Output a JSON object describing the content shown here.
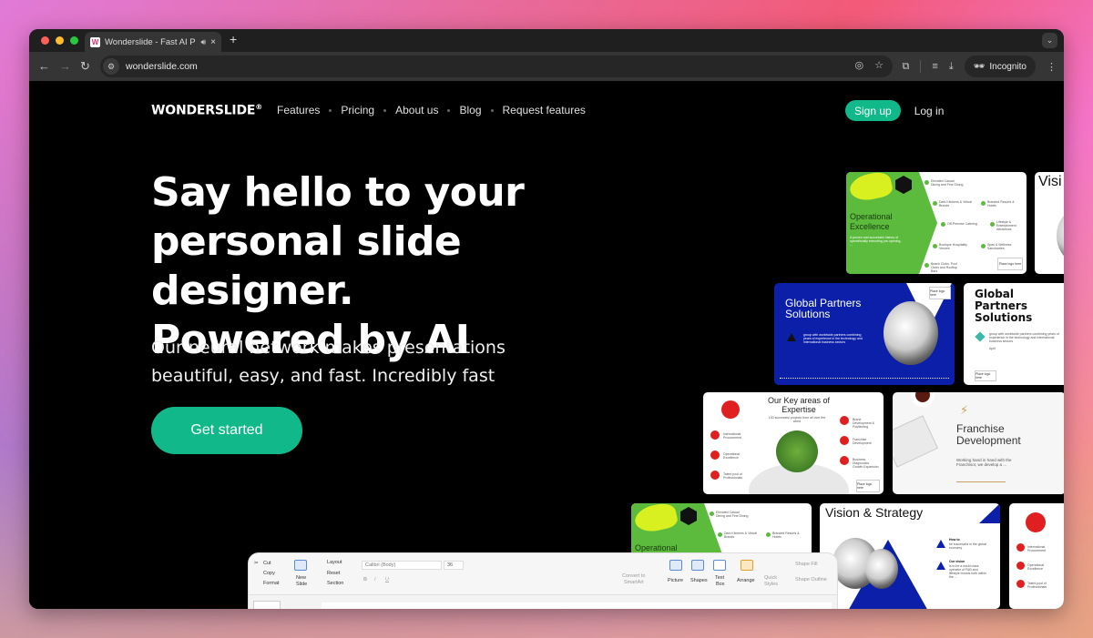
{
  "browser": {
    "tab": {
      "favicon": "W",
      "title": "Wonderslide - Fast AI Presentation Maker",
      "audio_icon": "speaker-icon",
      "close_icon": "×"
    },
    "new_tab": "+",
    "tab_dropdown": "⌄",
    "nav": {
      "back": "←",
      "forward": "→",
      "reload": "↻"
    },
    "address": {
      "site_info_icon": "tune-icon",
      "url": "wonderslide.com"
    },
    "omnibox_icons": [
      "eye-off-icon",
      "star-icon"
    ],
    "right_icons": [
      "extensions-icon",
      "reading-list-icon",
      "download-icon"
    ],
    "incognito_label": "Incognito",
    "menu_icon": "⋮"
  },
  "site": {
    "brand": "WONDERSLIDE",
    "brand_mark": "®",
    "nav_links": [
      "Features",
      "Pricing",
      "About us",
      "Blog",
      "Request features"
    ],
    "signup": "Sign up",
    "login": "Log in",
    "hero": {
      "title_lines": [
        "Say hello to your",
        "personal slide designer.",
        "Powered by AI"
      ],
      "subtitle_lines": [
        "Our neural network makes presentations",
        "beautiful, easy, and fast. Incredibly fast"
      ],
      "cta": "Get started"
    },
    "accent_color": "#11b98a",
    "slides": {
      "operational": {
        "title_lines": [
          "Operational",
          "Excellence"
        ],
        "body": "A proven and successful history of operationally executing pre-opening, ...",
        "items": [
          "Elevated Casual Dining and Fine Dining",
          "Dark Kitchens & Virtual Brands",
          "Off-Premise Catering",
          "Boutique Hospitality Venues",
          "Beach Clubs, Pool Clubs and Rooftop Bars",
          "Branded Resorts & Hotels",
          "Lifestyle & Entertainment Attractions",
          "Spas & Wellness Sanctuaries"
        ],
        "logo_placeholder": "Place logo here"
      },
      "vision_partial": {
        "title": "Visi"
      },
      "global_blue": {
        "title_lines": [
          "Global Partners",
          "Solutions"
        ],
        "body": "group with worldwide partners combining years of experience in the technology and international business sectors",
        "logo_placeholder": "Place logo here"
      },
      "global_white": {
        "title_lines": [
          "Global",
          "Partners",
          "Solutions"
        ],
        "body": "group with worldwide partners combining years of experience in the technology and international business sectors",
        "date": "April",
        "logo_placeholder": "Place logo here"
      },
      "expertise": {
        "title_lines": [
          "Our Key areas of",
          "Expertise"
        ],
        "subtitle": "100 successful projects from all over the world",
        "left_items": [
          "International Procurement",
          "Operational Excellence",
          "Talent pool of Professionals"
        ],
        "right_items": [
          "Brand Development & Positioning",
          "Franchise Development",
          "Business Diagnostics Growth Expansion"
        ],
        "logo_placeholder": "Place logo here"
      },
      "franchise": {
        "title_lines": [
          "Franchise",
          "Development"
        ],
        "body": "Working hand in hand with the Franchisor, we develop a ..."
      },
      "vision_strategy": {
        "title": "Vision & Strategy",
        "points": [
          {
            "heading": "How to",
            "text": "be successful in the global economy"
          },
          {
            "heading": "Our vision",
            "text": "is to be a world class operator of F&B and lifestyle brands both within the ..."
          }
        ]
      },
      "red_partial": {
        "items": [
          "International Procurement",
          "Operational Excellence",
          "Talent pool of Professionals"
        ]
      }
    },
    "ppt_ribbon": {
      "clipboard": [
        "Cut",
        "Copy",
        "Format"
      ],
      "new_slide": [
        "New",
        "Slide"
      ],
      "slide_group": [
        "Layout",
        "Reset",
        "Section"
      ],
      "font_name": "Calibri (Body)",
      "font_size": "36",
      "convert": [
        "Convert to",
        "SmartArt"
      ],
      "insert": [
        "Picture",
        "Shapes",
        "Text",
        "Box"
      ],
      "arrange": "Arrange",
      "quick_styles": [
        "Quick",
        "Styles"
      ],
      "shape_fill": "Shape Fill",
      "shape_outline": "Shape Outline"
    }
  }
}
